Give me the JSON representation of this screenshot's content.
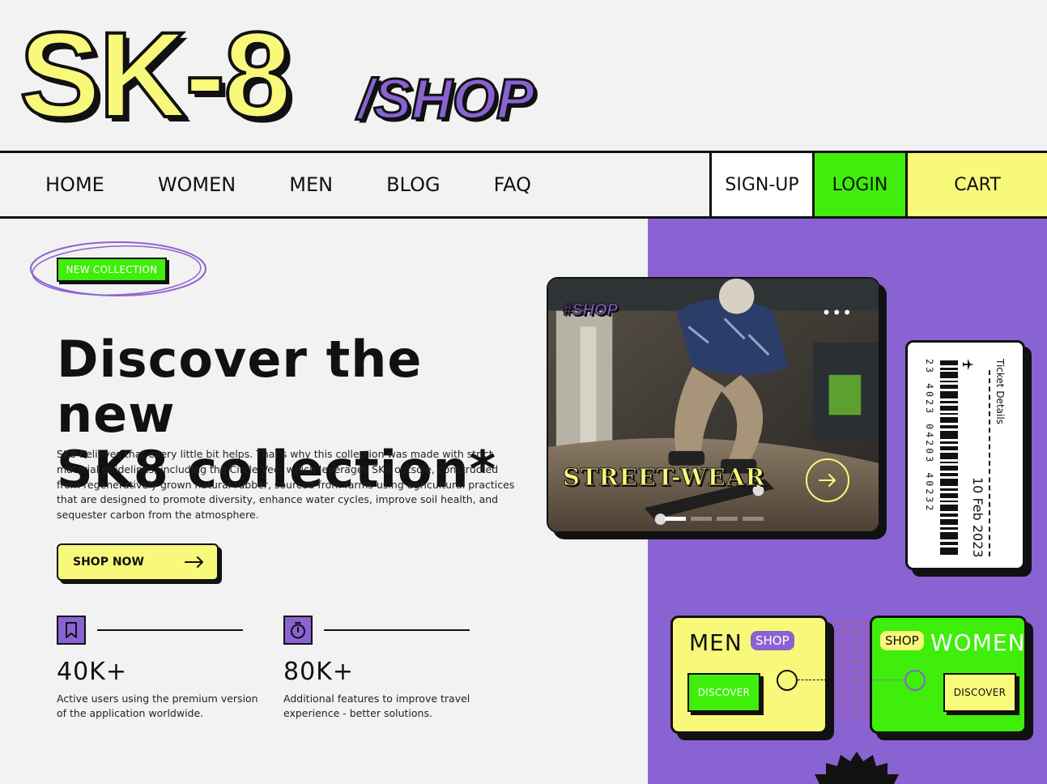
{
  "brand": {
    "logo_main": "SK-8",
    "logo_sub": "/SHOP"
  },
  "nav": {
    "links": [
      "HOME",
      "WOMEN",
      "MEN",
      "BLOG",
      "FAQ"
    ],
    "signup": "SIGN-UP",
    "login": "LOGIN",
    "cart": "CART"
  },
  "hero": {
    "badge": "NEW COLLECTION",
    "title_line1": "Discover the new",
    "title_line2": "SK8 collection*",
    "description": "SK8 believes that every little bit helps. That's why this collection was made with strict material guidelines, including the Circle Vee, which leverages SK8 outsole, constructed from regeneratively grown natural rubber, sourced from farms using agricultural practices that are designed to promote diversity, enhance water cycles, improve soil health, and sequester carbon from the atmosphere.",
    "cta": "SHOP NOW"
  },
  "stats": [
    {
      "icon": "bookmark-icon",
      "value": "40K+",
      "label": "Active users using the premium version of the application worldwide."
    },
    {
      "icon": "stopwatch-icon",
      "value": "80K+",
      "label": "Additional features to improve travel experience - better solutions."
    }
  ],
  "photo_card": {
    "tag": "#SHOP",
    "menu": "•••",
    "caption": "STREET-WEAR",
    "slides_total": 4,
    "slide_active": 1
  },
  "ticket": {
    "number": "23 4023 04203 40232",
    "date": "10 Feb 2023",
    "label": "Ticket Details",
    "icon": "airplane-icon"
  },
  "categories": {
    "men": {
      "title": "MEN",
      "pill": "SHOP",
      "button": "DISCOVER"
    },
    "women": {
      "title": "WOMEN",
      "pill": "SHOP",
      "button": "DISCOVER"
    }
  },
  "colors": {
    "yellow": "#f8f87a",
    "green": "#3fee0a",
    "purple": "#8a63d2",
    "ink": "#111111",
    "background": "#f2f2f2"
  }
}
